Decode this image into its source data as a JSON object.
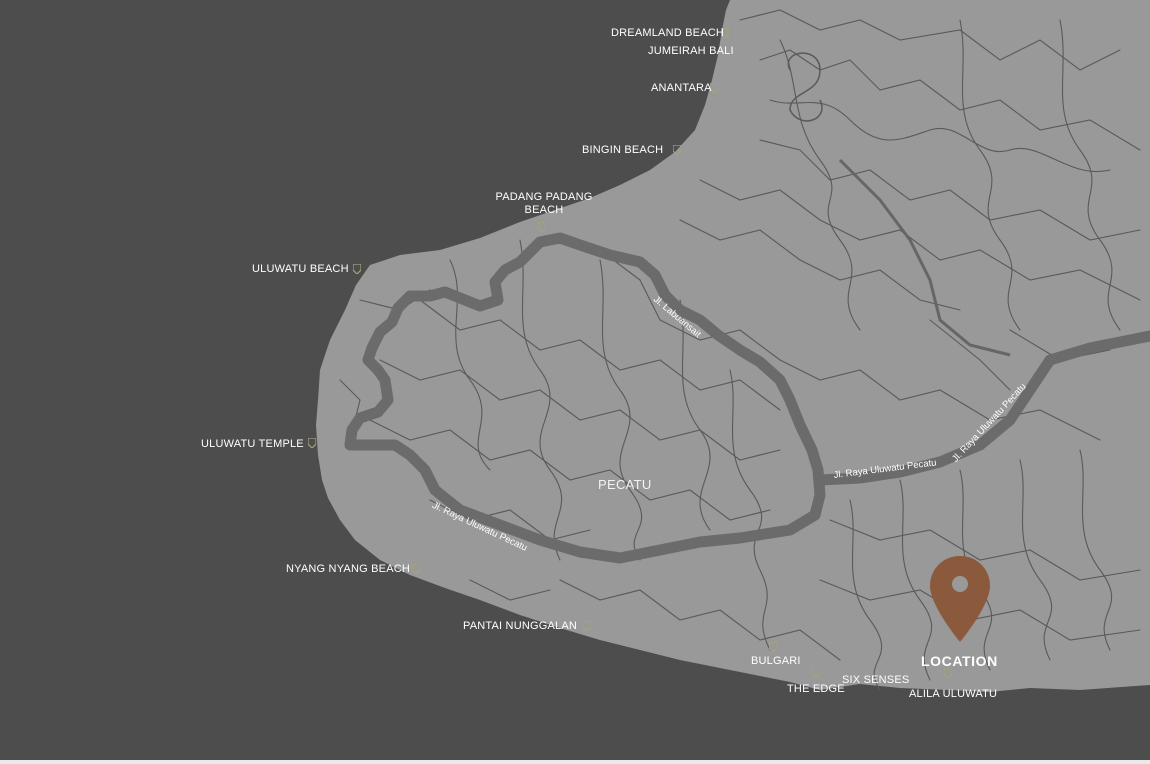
{
  "map": {
    "colors": {
      "sea": "#4d4d4d",
      "land": "#999999",
      "roads": "#575757",
      "main_road": "#6b6b6b",
      "pin": "#8b5a3c",
      "poi_marker": "#a8a37a",
      "label": "#ffffff"
    },
    "icons": {
      "poi": "poi-marker-icon",
      "location": "location-pin-icon"
    }
  },
  "places": {
    "dreamland": "DREAMLAND BEACH",
    "jumeirah": "JUMEIRAH BALI",
    "anantara": "ANANTARA",
    "bingin": "BINGIN BEACH",
    "padang_line1": "PADANG PADANG",
    "padang_line2": "BEACH",
    "uluwatu_beach": "ULUWATU BEACH",
    "uluwatu_temple": "ULUWATU TEMPLE",
    "nyang_nyang": "NYANG NYANG BEACH",
    "nunggalan": "PANTAI NUNGGALAN",
    "bulgari": "BULGARI",
    "the_edge": "THE EDGE",
    "six_senses": "SIX SENSES",
    "alila": "ALILA ULUWATU"
  },
  "town": "PECATU",
  "roads": {
    "labuansait": "Jl. Labuansait",
    "uluwatu_pecatu_west": "Jl. Raya Uluwatu Pecatu",
    "uluwatu_pecatu_mid": "Jl. Raya Uluwatu Pecatu",
    "uluwatu_pecatu_east": "Jl. Raya Uluwatu Pecatu"
  },
  "location_label": "LOCATION"
}
